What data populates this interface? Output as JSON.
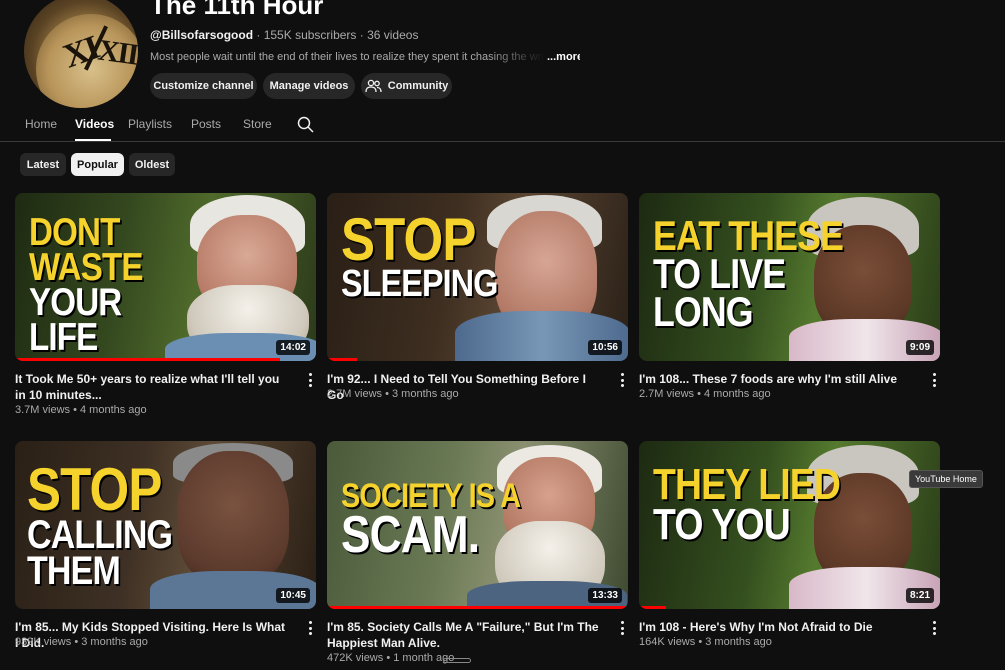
{
  "channel": {
    "title": "The 11th Hour",
    "handle": "@Billsofarsogood",
    "meta_rest": " · 155K subscribers · 36 videos",
    "description": "Most people wait until the end of their lives to realize they spent it chasing the wrong thi",
    "more_label": "...more",
    "avatar_numerals": [
      "XI",
      "XII"
    ]
  },
  "actions": {
    "customize": "Customize channel",
    "manage": "Manage videos",
    "community": "Community"
  },
  "tabs": [
    "Home",
    "Videos",
    "Playlists",
    "Posts",
    "Store"
  ],
  "active_tab": "Videos",
  "chips": [
    "Latest",
    "Popular",
    "Oldest"
  ],
  "active_chip": "Popular",
  "colors": {
    "background": "#0f0f0f",
    "chip_active": "#f1f1f1",
    "progress": "#ff0000",
    "caption_yellow": "#f5d32c"
  },
  "videos": [
    {
      "caption": [
        "DONT",
        "WASTE",
        "YOUR",
        "LIFE"
      ],
      "caption_colors": [
        "yellow",
        "yellow",
        "white",
        "white"
      ],
      "duration": "14:02",
      "progress": 0.88,
      "title": "It Took Me 50+ years to realize what I'll tell you in 10 minutes...",
      "views": "3.7M views",
      "age": "4 months ago"
    },
    {
      "caption": [
        "STOP",
        "SLEEPING"
      ],
      "caption_colors": [
        "yellow",
        "white"
      ],
      "duration": "10:56",
      "progress": 0.1,
      "title": "I'm 92... I Need to Tell You Something Before I Go",
      "views": "2.7M views",
      "age": "3 months ago"
    },
    {
      "caption": [
        "EAT THESE",
        "TO LIVE",
        "LONG"
      ],
      "caption_colors": [
        "yellow",
        "white",
        "white"
      ],
      "duration": "9:09",
      "progress": 0,
      "title": "I'm 108... These 7 foods are why I'm still Alive",
      "views": "2.7M views",
      "age": "4 months ago"
    },
    {
      "caption": [
        "STOP",
        "CALLING",
        "THEM"
      ],
      "caption_colors": [
        "yellow",
        "white",
        "white"
      ],
      "duration": "10:45",
      "progress": 0,
      "title": "I'm 85... My Kids Stopped Visiting. Here Is What I Did.",
      "views": "939K views",
      "age": "3 months ago"
    },
    {
      "caption": [
        "SOCIETY IS A",
        "SCAM."
      ],
      "caption_colors": [
        "yellow",
        "white"
      ],
      "duration": "13:33",
      "progress": 1,
      "title": "I'm 85. Society Calls Me A \"Failure,\" But I'm The Happiest Man Alive.",
      "views": "472K views",
      "age": "1 month ago"
    },
    {
      "caption": [
        "THEY LIED",
        "TO YOU"
      ],
      "caption_colors": [
        "yellow",
        "white"
      ],
      "duration": "8:21",
      "progress": 0.09,
      "title": "I'm 108 - Here's Why I'm Not Afraid to Die",
      "views": "164K views",
      "age": "3 months ago"
    }
  ],
  "tooltip": "YouTube Home",
  "icons": {
    "search": "search-icon",
    "community": "people-icon",
    "more": "kebab-icon"
  }
}
